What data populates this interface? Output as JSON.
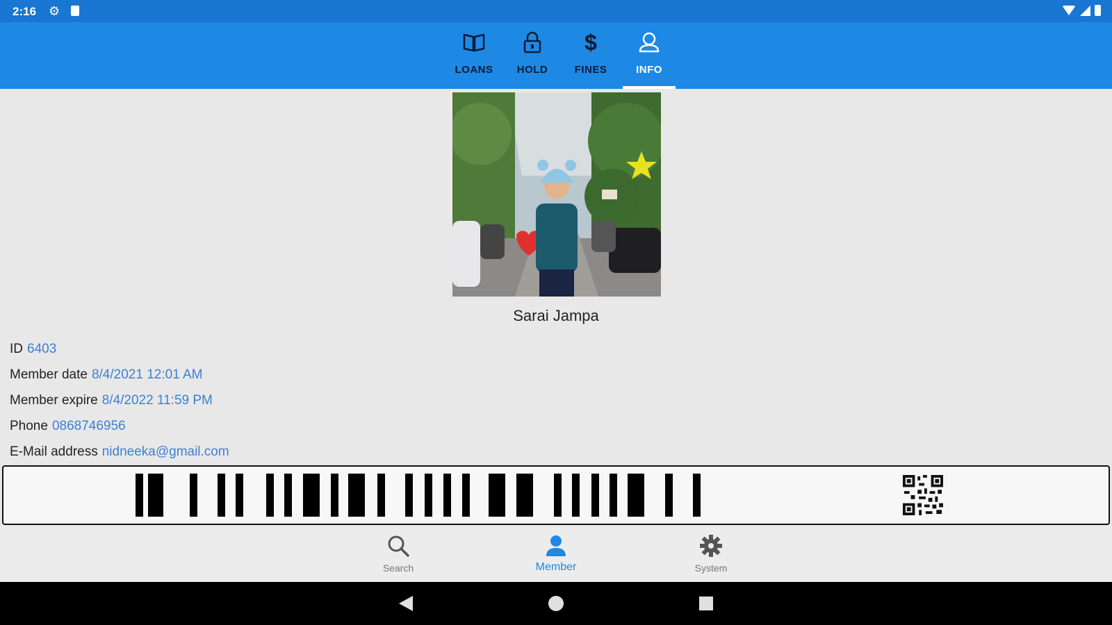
{
  "status_bar": {
    "time": "2:16",
    "icons": [
      "settings-icon",
      "sd-card-icon",
      "wifi-icon",
      "cell-signal-icon",
      "battery-icon"
    ]
  },
  "tabs": [
    {
      "label": "LOANS",
      "icon": "book-icon",
      "active": false
    },
    {
      "label": "HOLD",
      "icon": "lock-icon",
      "active": false
    },
    {
      "label": "FINES",
      "icon": "dollar-icon",
      "glyph": "$",
      "active": false
    },
    {
      "label": "INFO",
      "icon": "person-icon",
      "active": true
    }
  ],
  "member": {
    "name": "Sarai Jampa",
    "fields": [
      {
        "label": "ID",
        "value": "6403"
      },
      {
        "label": "Member date",
        "value": "8/4/2021 12:01 AM"
      },
      {
        "label": "Member expire",
        "value": "8/4/2022 11:59 PM"
      },
      {
        "label": "Phone",
        "value": "0868746956"
      },
      {
        "label": "E-Mail address",
        "value": "nidneeka@gmail.com"
      }
    ]
  },
  "barcode": {
    "icon": "barcode-graphic",
    "qr_icon": "qr-code-icon"
  },
  "bottom_nav": [
    {
      "label": "Search",
      "icon": "search-icon",
      "active": false
    },
    {
      "label": "Member",
      "icon": "person-icon",
      "active": true
    },
    {
      "label": "System",
      "icon": "gear-icon",
      "active": false
    }
  ],
  "colors": {
    "status_bar": "#1976d2",
    "app_bar": "#1e88e5",
    "accent": "#1e88e5",
    "link": "#3d7fd6",
    "background": "#e8e8e8"
  }
}
